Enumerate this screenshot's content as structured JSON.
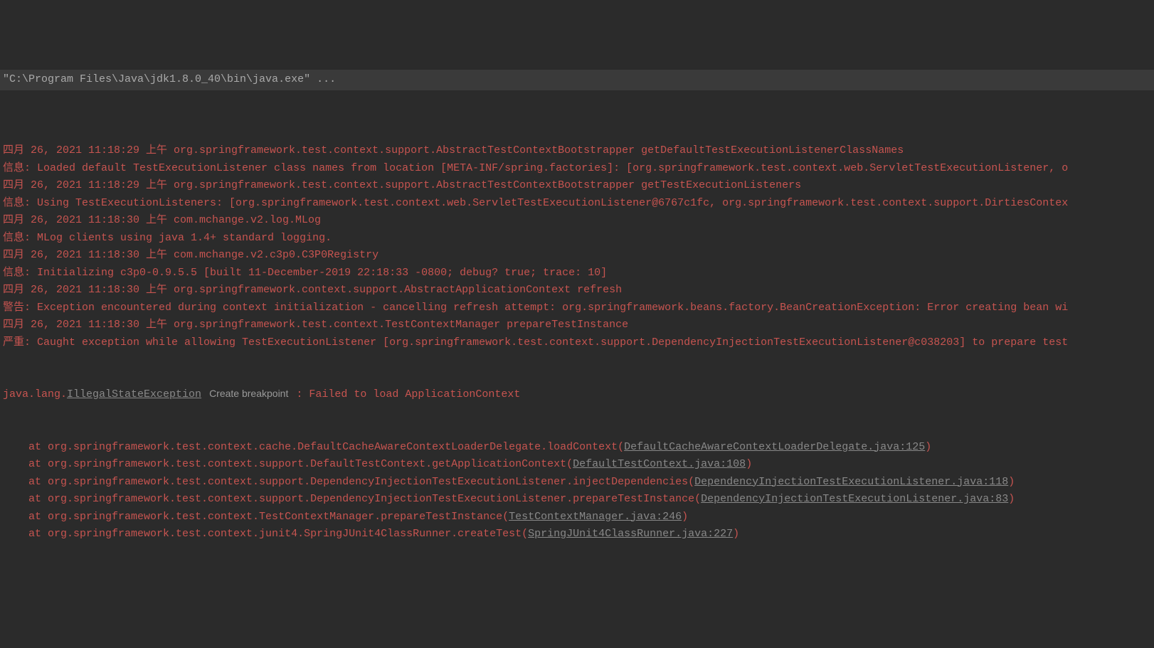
{
  "command_line": "\"C:\\Program Files\\Java\\jdk1.8.0_40\\bin\\java.exe\" ...",
  "lines": [
    {
      "type": "log",
      "text": "四月 26, 2021 11:18:29 上午 org.springframework.test.context.support.AbstractTestContextBootstrapper getDefaultTestExecutionListenerClassNames"
    },
    {
      "type": "log",
      "text": "信息: Loaded default TestExecutionListener class names from location [META-INF/spring.factories]: [org.springframework.test.context.web.ServletTestExecutionListener, o"
    },
    {
      "type": "log",
      "text": "四月 26, 2021 11:18:29 上午 org.springframework.test.context.support.AbstractTestContextBootstrapper getTestExecutionListeners"
    },
    {
      "type": "log",
      "text": "信息: Using TestExecutionListeners: [org.springframework.test.context.web.ServletTestExecutionListener@6767c1fc, org.springframework.test.context.support.DirtiesContex"
    },
    {
      "type": "log",
      "text": "四月 26, 2021 11:18:30 上午 com.mchange.v2.log.MLog"
    },
    {
      "type": "log",
      "text": "信息: MLog clients using java 1.4+ standard logging."
    },
    {
      "type": "log",
      "text": "四月 26, 2021 11:18:30 上午 com.mchange.v2.c3p0.C3P0Registry"
    },
    {
      "type": "log",
      "text": "信息: Initializing c3p0-0.9.5.5 [built 11-December-2019 22:18:33 -0800; debug? true; trace: 10]"
    },
    {
      "type": "log",
      "text": "四月 26, 2021 11:18:30 上午 org.springframework.context.support.AbstractApplicationContext refresh"
    },
    {
      "type": "log",
      "text": "警告: Exception encountered during context initialization - cancelling refresh attempt: org.springframework.beans.factory.BeanCreationException: Error creating bean wi"
    },
    {
      "type": "log",
      "text": "四月 26, 2021 11:18:30 上午 org.springframework.test.context.TestContextManager prepareTestInstance"
    },
    {
      "type": "log",
      "text": "严重: Caught exception while allowing TestExecutionListener [org.springframework.test.context.support.DependencyInjectionTestExecutionListener@c038203] to prepare test"
    }
  ],
  "exception_line": {
    "prefix": "java.lang.",
    "exception_link": "IllegalStateException",
    "breakpoint_label": "Create breakpoint",
    "suffix": " : Failed to load ApplicationContext"
  },
  "stack_trace": [
    {
      "prefix": "    at org.springframework.test.context.cache.DefaultCacheAwareContextLoaderDelegate.loadContext(",
      "link": "DefaultCacheAwareContextLoaderDelegate.java:125",
      "suffix": ")"
    },
    {
      "prefix": "    at org.springframework.test.context.support.DefaultTestContext.getApplicationContext(",
      "link": "DefaultTestContext.java:108",
      "suffix": ")"
    },
    {
      "prefix": "    at org.springframework.test.context.support.DependencyInjectionTestExecutionListener.injectDependencies(",
      "link": "DependencyInjectionTestExecutionListener.java:118",
      "suffix": ")"
    },
    {
      "prefix": "    at org.springframework.test.context.support.DependencyInjectionTestExecutionListener.prepareTestInstance(",
      "link": "DependencyInjectionTestExecutionListener.java:83",
      "suffix": ")"
    },
    {
      "prefix": "    at org.springframework.test.context.TestContextManager.prepareTestInstance(",
      "link": "TestContextManager.java:246",
      "suffix": ")"
    },
    {
      "prefix": "    at org.springframework.test.context.junit4.SpringJUnit4ClassRunner.createTest(",
      "link": "SpringJUnit4ClassRunner.java:227",
      "suffix": ")"
    }
  ]
}
